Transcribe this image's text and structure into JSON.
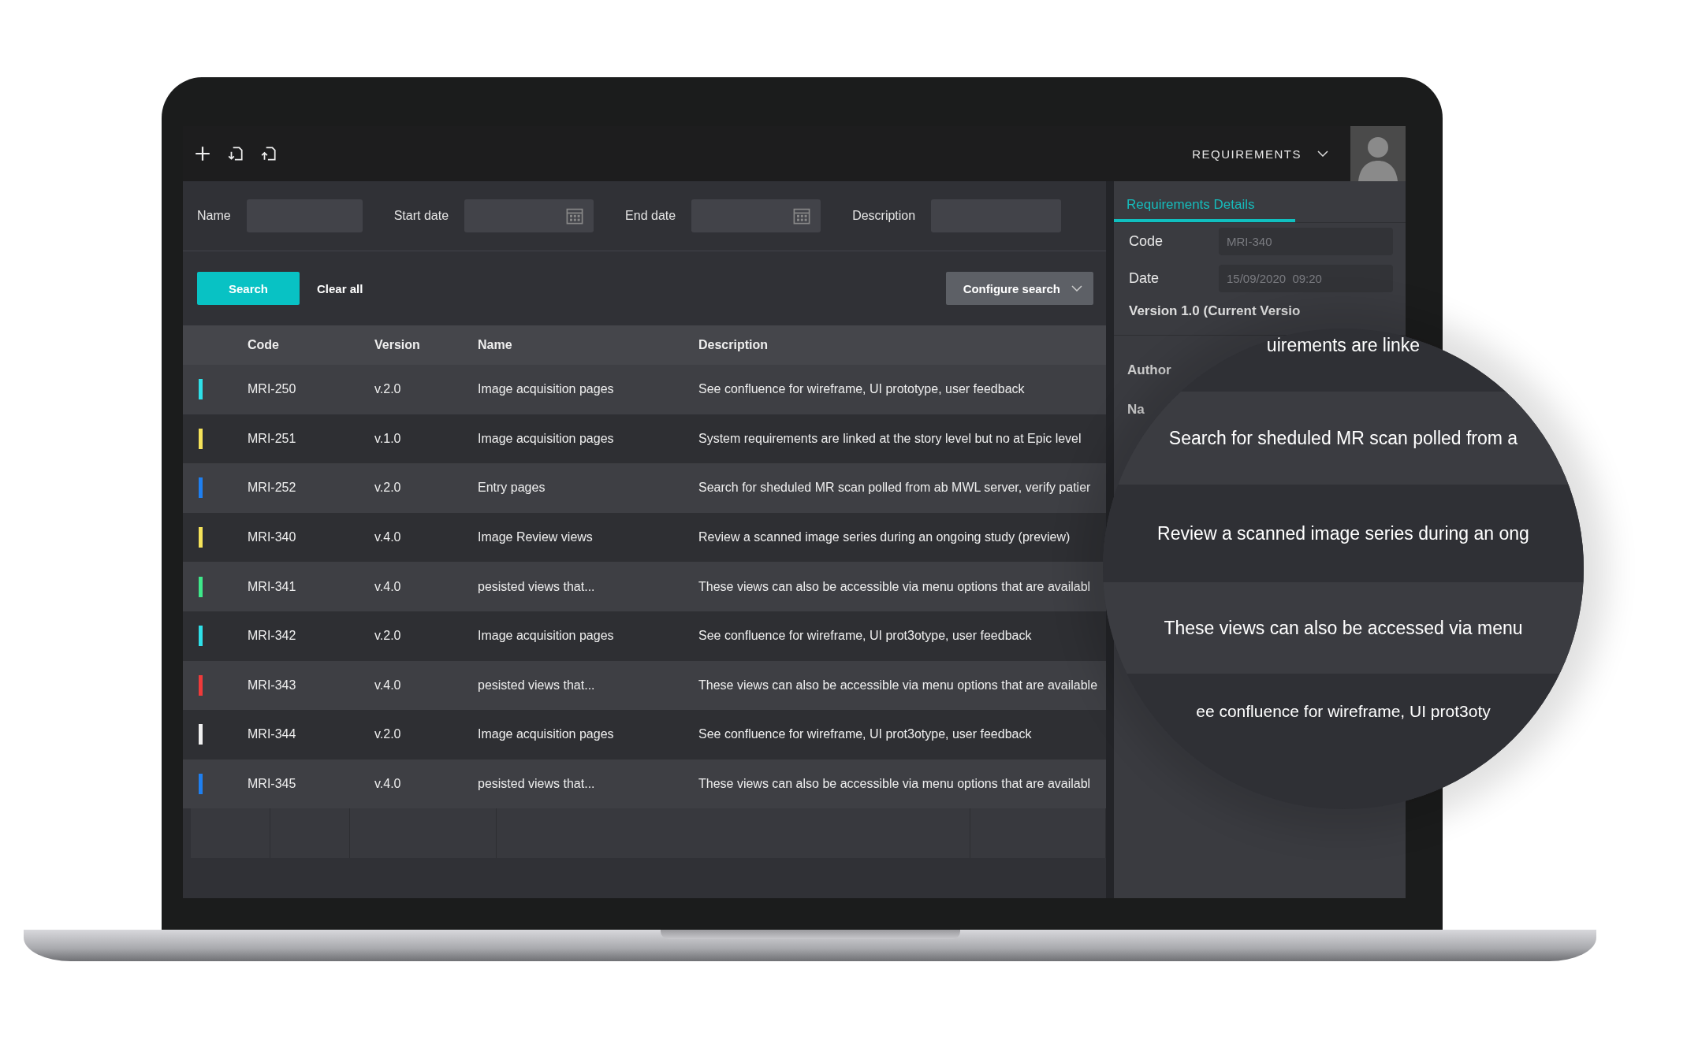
{
  "toolbar": {
    "menu": "REQUIREMENTS"
  },
  "filters": [
    {
      "label": "Name",
      "kind": "text"
    },
    {
      "label": "Start date",
      "kind": "date"
    },
    {
      "label": "End date",
      "kind": "date"
    },
    {
      "label": "Description",
      "kind": "text"
    }
  ],
  "actions": {
    "search": "Search",
    "clear": "Clear all",
    "configure": "Configure search"
  },
  "table": {
    "columns": [
      "Code",
      "Version",
      "Name",
      "Description"
    ],
    "rows": [
      {
        "color": "#2ee0e8",
        "code": "MRI-250",
        "version": "v.2.0",
        "name": "Image acquisition pages",
        "description": "See confluence for wireframe, UI prototype, user feedback"
      },
      {
        "color": "#f5e35a",
        "code": "MRI-251",
        "version": "v.1.0",
        "name": "Image acquisition pages",
        "description": "System requirements are linked at the story level but no at Epic level"
      },
      {
        "color": "#1e7ff0",
        "code": "MRI-252",
        "version": "v.2.0",
        "name": "Entry pages",
        "description": "Search for sheduled MR scan polled from ab MWL server, verify patier"
      },
      {
        "color": "#f5e35a",
        "code": "MRI-340",
        "version": "v.4.0",
        "name": "Image Review views",
        "description": "Review a scanned image series during an ongoing  study (preview)"
      },
      {
        "color": "#3ee88a",
        "code": "MRI-341",
        "version": "v.4.0",
        "name": "pesisted views that...",
        "description": "These views can also be accessible via menu options that are availabl"
      },
      {
        "color": "#2ee0e8",
        "code": "MRI-342",
        "version": "v.2.0",
        "name": "Image acquisition pages",
        "description": "See confluence for wireframe, UI prot3otype, user feedback"
      },
      {
        "color": "#f03a3a",
        "code": "MRI-343",
        "version": "v.4.0",
        "name": "pesisted views that...",
        "description": "These views can also be accessible via menu options that are available"
      },
      {
        "color": "#f0f0f0",
        "code": "MRI-344",
        "version": "v.2.0",
        "name": "Image acquisition pages",
        "description": "See confluence for wireframe, UI prot3otype, user feedback"
      },
      {
        "color": "#1e7ff0",
        "code": "MRI-345",
        "version": "v.4.0",
        "name": "pesisted views that...",
        "description": "These views can also be accessible via menu options that are availabl"
      }
    ]
  },
  "details": {
    "tabs": [
      {
        "label": "Requirements Details",
        "selected": true
      }
    ],
    "fields": [
      {
        "label": "Code",
        "value": "MRI-340"
      },
      {
        "label": "Date",
        "value": "15/09/2020  09:20"
      }
    ],
    "version": "Version 1.0 (Current Versio",
    "author": "Author",
    "name_label": "Na"
  },
  "magnifier": [
    "uirements are linke",
    "Search for sheduled MR scan polled from a",
    "Review a scanned image series during an ong",
    "These views can also be accessed via menu",
    "ee confluence for wireframe, UI prot3oty"
  ]
}
